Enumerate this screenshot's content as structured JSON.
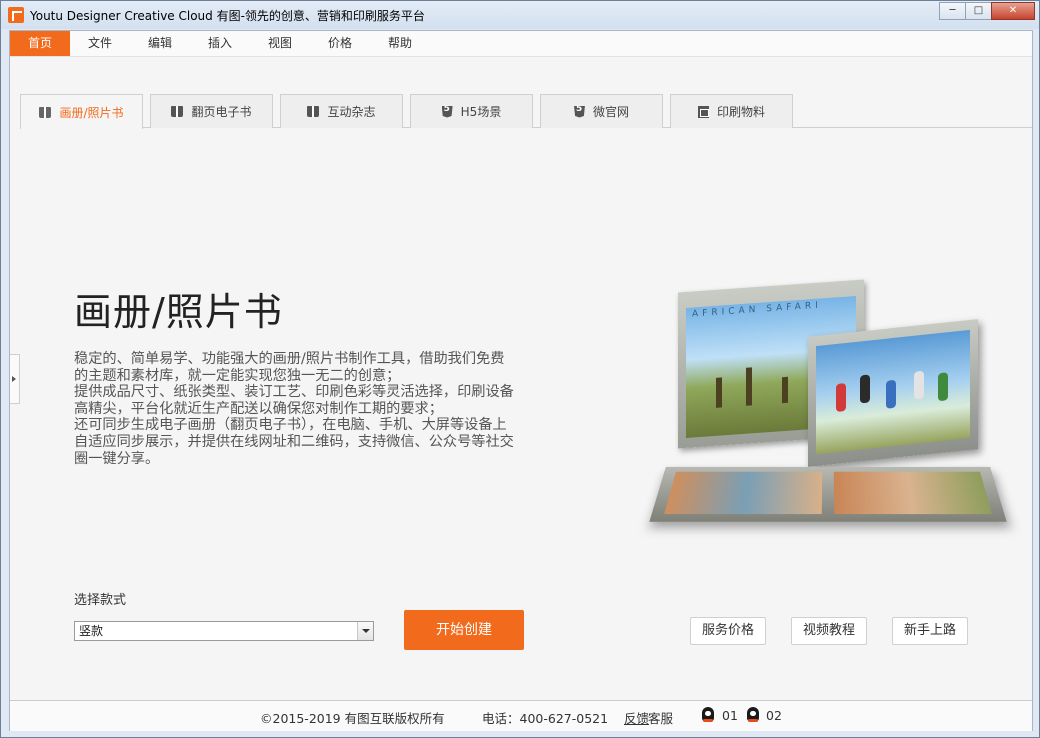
{
  "window": {
    "title": "Youtu Designer Creative Cloud 有图-领先的创意、营销和印刷服务平台",
    "buttons": {
      "minimize": "─",
      "maximize": "□",
      "close": "✕"
    }
  },
  "menu": {
    "items": [
      {
        "label": "首页",
        "active": true
      },
      {
        "label": "文件",
        "active": false
      },
      {
        "label": "编辑",
        "active": false
      },
      {
        "label": "插入",
        "active": false
      },
      {
        "label": "视图",
        "active": false
      },
      {
        "label": "价格",
        "active": false
      },
      {
        "label": "帮助",
        "active": false
      }
    ]
  },
  "tabs": [
    {
      "label": "画册/照片书",
      "icon": "book-icon",
      "active": true
    },
    {
      "label": "翻页电子书",
      "icon": "book-icon",
      "active": false
    },
    {
      "label": "互动杂志",
      "icon": "book-icon",
      "active": false
    },
    {
      "label": "H5场景",
      "icon": "html5-icon",
      "active": false
    },
    {
      "label": "微官网",
      "icon": "html5-icon",
      "active": false
    },
    {
      "label": "印刷物料",
      "icon": "print-icon",
      "active": false
    }
  ],
  "main": {
    "title": "画册/照片书",
    "description_lines": [
      "稳定的、简单易学、功能强大的画册/照片书制作工具，借助我们免费",
      "的主题和素材库，就一定能实现您独一无二的创意；",
      "提供成品尺寸、纸张类型、装订工艺、印刷色彩等灵活选择，印刷设备",
      "高精尖，平台化就近生产配送以确保您对制作工期的要求；",
      "还可同步生成电子画册（翻页电子书），在电脑、手机、大屏等设备上",
      "自适应同步展示，并提供在线网址和二维码，支持微信、公众号等社交",
      "圈一键分享。"
    ],
    "album_cover_text": "AFRICAN SAFARI"
  },
  "controls": {
    "select_label": "选择款式",
    "select_value": "竖款",
    "start_button": "开始创建",
    "service_price": "服务价格",
    "video_tutorial": "视频教程",
    "beginner_guide": "新手上路"
  },
  "footer": {
    "copyright": "©2015-2019 有图互联版权所有",
    "phone": "电话：400-627-0521",
    "feedback": "反馈",
    "support": "客服",
    "qq1": "01",
    "qq2": "02"
  },
  "colors": {
    "accent": "#f26a1b"
  }
}
